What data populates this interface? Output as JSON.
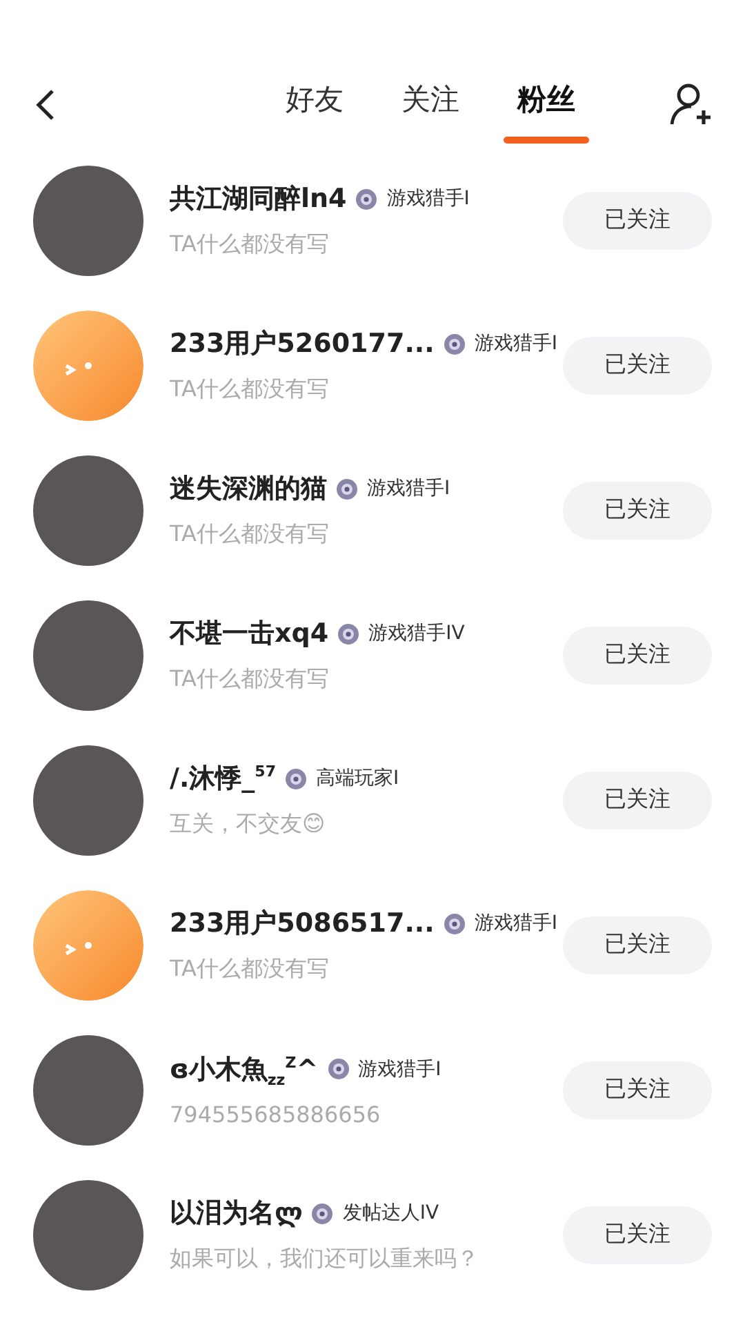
{
  "tabs": [
    {
      "label": "好友",
      "selected": false
    },
    {
      "label": "关注",
      "selected": false
    },
    {
      "label": "粉丝",
      "selected": true
    }
  ],
  "users": [
    {
      "kind": "photo",
      "name": "共江湖同醉ln4",
      "badge": "游戏猎手I",
      "bio": "TA什么都没有写",
      "button": "已关注"
    },
    {
      "kind": "default",
      "name": "233用户5260177...",
      "badge": "游戏猎手I",
      "bio": "TA什么都没有写",
      "button": "已关注"
    },
    {
      "kind": "photo",
      "name": "迷失深渊的猫",
      "badge": "游戏猎手I",
      "bio": "TA什么都没有写",
      "button": "已关注"
    },
    {
      "kind": "photo",
      "name": "不堪一击xq4",
      "badge": "游戏猎手IV",
      "bio": "TA什么都没有写",
      "button": "已关注"
    },
    {
      "kind": "photo",
      "name": "/.沐悸_$^{57}$",
      "badge": "高端玩家I",
      "bio": "互关，不交友😊",
      "button": "已关注"
    },
    {
      "kind": "default",
      "name": "233用户5086517...",
      "badge": "游戏猎手I",
      "bio": "TA什么都没有写",
      "button": "已关注"
    },
    {
      "kind": "photo",
      "name": "ɞ小木魚$_{zz}$$^{Z}$^",
      "badge": "游戏猎手I",
      "bio": "794555685886656",
      "button": "已关注"
    },
    {
      "kind": "photo",
      "name": "以泪为名ლ",
      "badge": "发帖达人IV",
      "bio": "如果可以，我们还可以重来吗？",
      "button": "已关注"
    }
  ]
}
